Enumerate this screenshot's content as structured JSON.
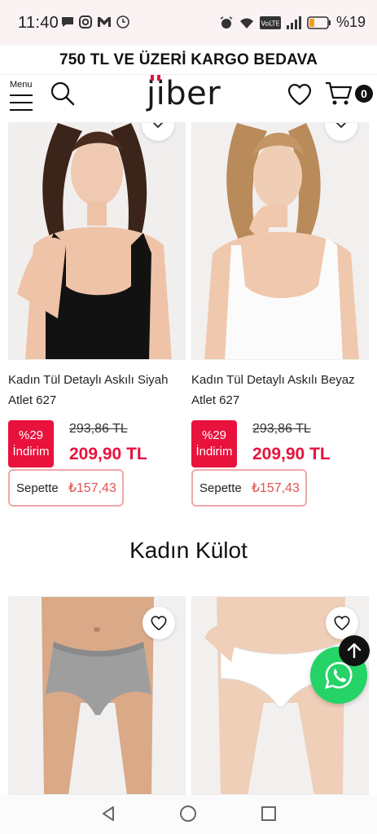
{
  "status_bar": {
    "time": "11:40",
    "battery_text": "%19",
    "left_icons": [
      "message-icon",
      "instagram-icon",
      "gmail-icon",
      "clock-icon"
    ],
    "right_icons": [
      "alarm-icon",
      "wifi-icon",
      "volte-icon",
      "signal-icon",
      "battery-icon"
    ],
    "volte_label": "VoLTE"
  },
  "promo": {
    "text": "750 TL VE ÜZERİ KARGO BEDAVA"
  },
  "header": {
    "menu_label": "Menu",
    "logo_text": "jiber",
    "cart_count": "0"
  },
  "products_top": [
    {
      "name_line1": "Kadın Tül Detaylı Askılı Siyah",
      "name_line2": "Atlet 627",
      "discount_pct": "%29",
      "discount_label": "İndirim",
      "old_price": "293,86 TL",
      "new_price": "209,90 TL",
      "basket_label": "Sepette",
      "basket_price": "₺157,43",
      "color": "black"
    },
    {
      "name_line1": "Kadın Tül Detaylı Askılı Beyaz",
      "name_line2": "Atlet 627",
      "discount_pct": "%29",
      "discount_label": "İndirim",
      "old_price": "293,86 TL",
      "new_price": "209,90 TL",
      "basket_label": "Sepette",
      "basket_price": "₺157,43",
      "color": "white"
    }
  ],
  "section": {
    "title": "Kadın Külot"
  },
  "colors": {
    "accent_red": "#e8123c",
    "basket_border": "#f0a9a9",
    "whatsapp_green": "#25d366"
  }
}
